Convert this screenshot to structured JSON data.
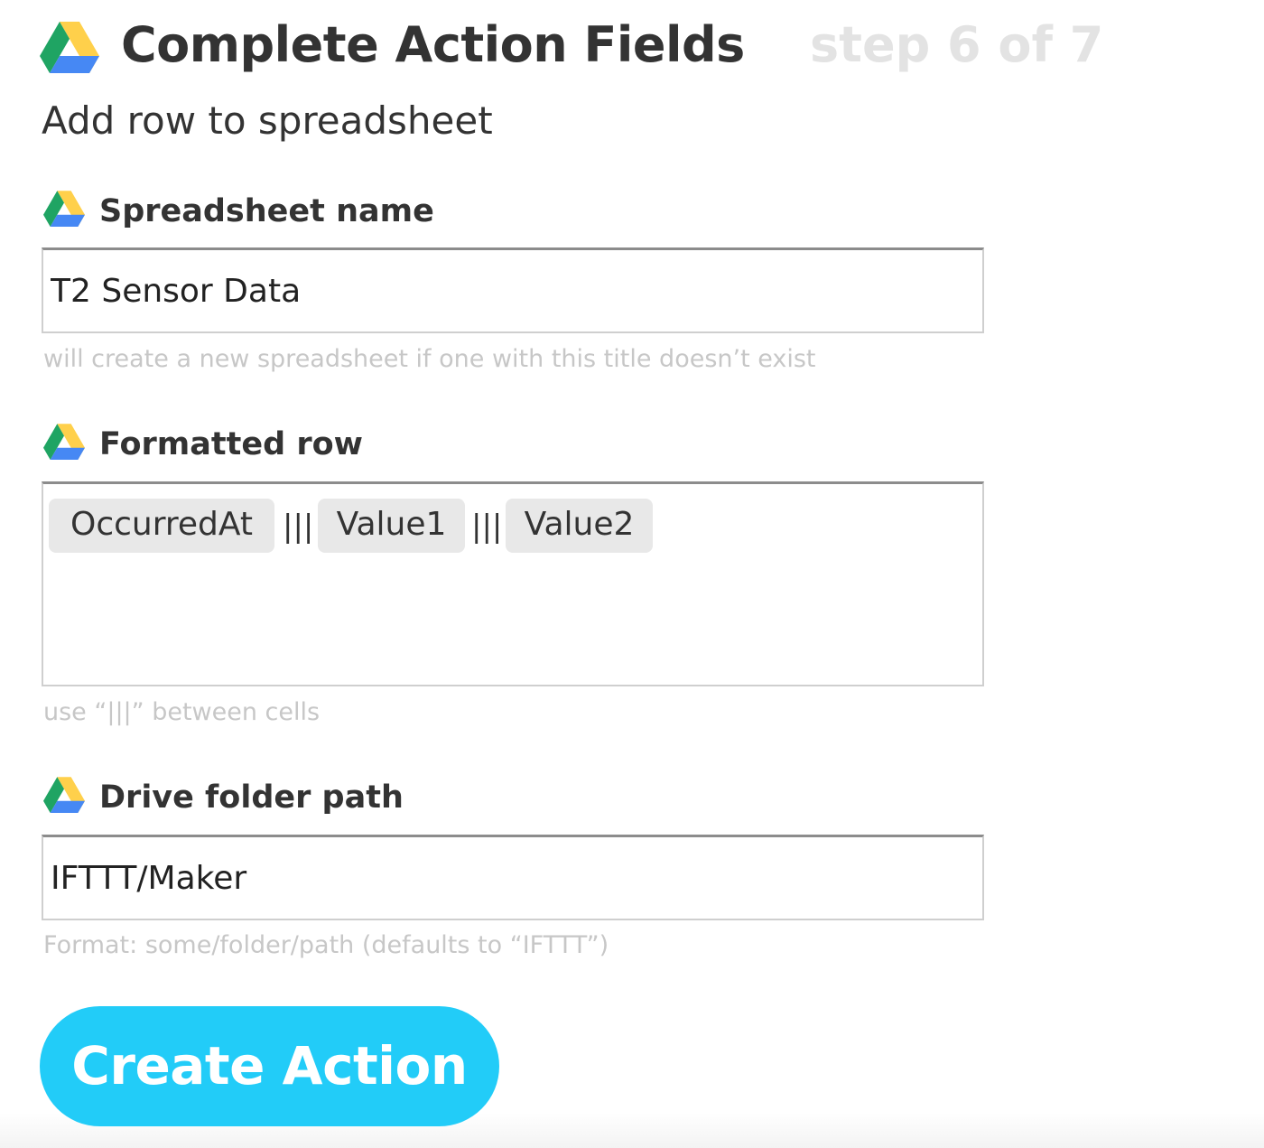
{
  "header": {
    "icon": "google-drive-icon",
    "title": "Complete Action Fields",
    "step": "step 6 of 7"
  },
  "action": {
    "subtitle": "Add row to spreadsheet"
  },
  "fields": {
    "spreadsheet_name": {
      "icon": "google-drive-icon",
      "label": "Spreadsheet name",
      "value": "T2 Sensor Data",
      "help": "will create a new spreadsheet if one with this title doesn’t exist"
    },
    "formatted_row": {
      "icon": "google-drive-icon",
      "label": "Formatted row",
      "ingredients": [
        "OccurredAt",
        "Value1",
        "Value2"
      ],
      "separator": "|||",
      "help": "use “|||” between cells"
    },
    "drive_folder_path": {
      "icon": "google-drive-icon",
      "label": "Drive folder path",
      "value": "IFTTT/Maker",
      "help": "Format: some/folder/path (defaults to “IFTTT”)"
    }
  },
  "button": {
    "label": "Create Action",
    "color": "#22ccf8"
  },
  "colors": {
    "drive_green": "#1fa463",
    "drive_yellow": "#ffd04b",
    "drive_blue": "#4688f4"
  }
}
